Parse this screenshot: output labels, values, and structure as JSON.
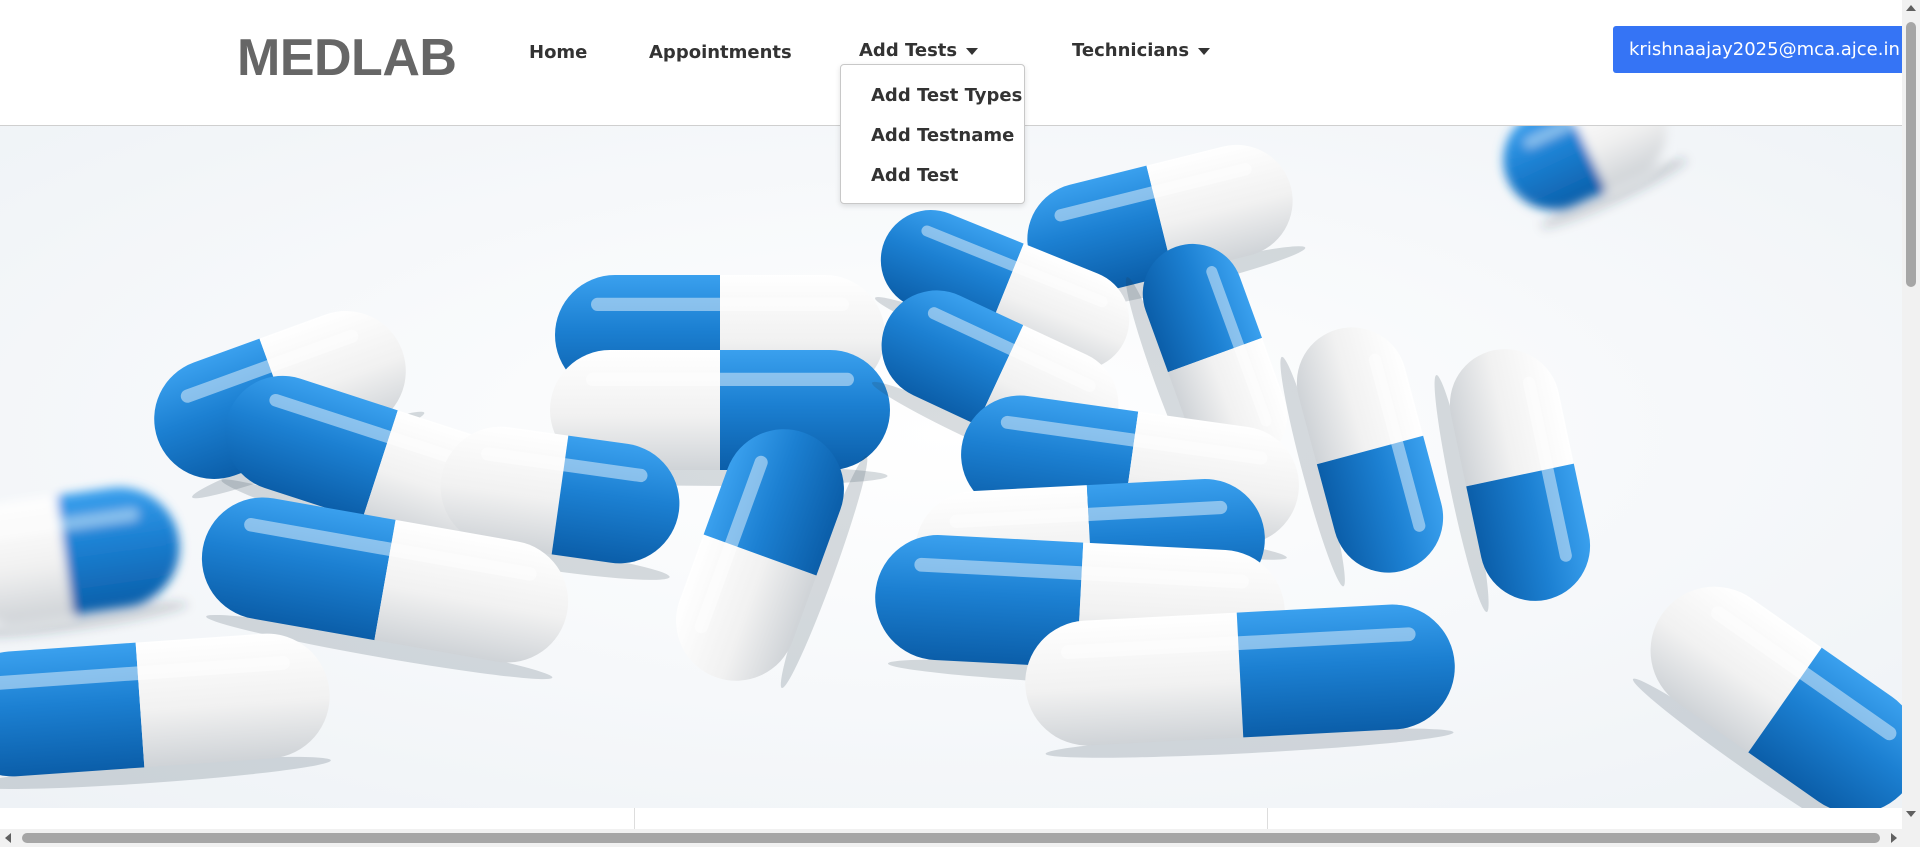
{
  "brand": "MEDLAB",
  "nav": {
    "home": "Home",
    "appointments": "Appointments",
    "add_tests": "Add Tests",
    "technicians": "Technicians"
  },
  "user": {
    "email": "krishnaajay2025@mca.ajce.in"
  },
  "dropdown": {
    "items": [
      "Add Test Types",
      "Add Testname",
      "Add Test"
    ]
  },
  "hero": {
    "image": "blue-white-capsules-photo"
  },
  "colors": {
    "accent": "#3574f5",
    "capsule_blue": "#1f7fd0",
    "capsule_white": "#f2f2f2",
    "brand_gray": "#666666"
  }
}
